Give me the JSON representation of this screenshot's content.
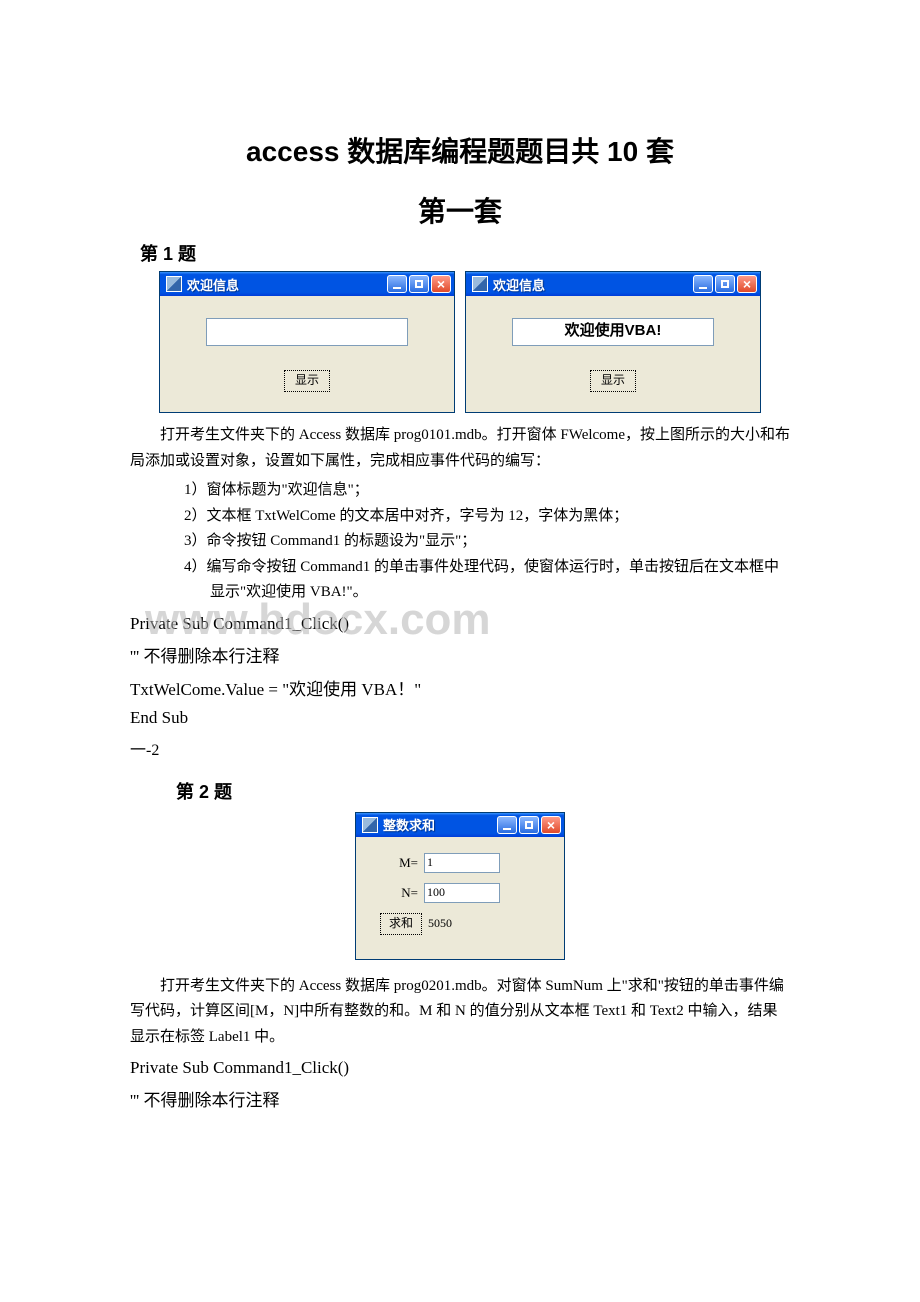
{
  "title": "access 数据库编程题题目共 10 套",
  "set_heading": "第一套",
  "watermark": "www.bdocx.com",
  "q1": {
    "header": "第 1 题",
    "win_left": {
      "title": "欢迎信息",
      "text_value": "",
      "button_label": "显示"
    },
    "win_right": {
      "title": "欢迎信息",
      "text_value": "欢迎使用VBA!",
      "button_label": "显示"
    },
    "para1": "打开考生文件夹下的 Access 数据库 prog0101.mdb。打开窗体 FWelcome，按上图所示的大小和布局添加或设置对象，设置如下属性，完成相应事件代码的编写：",
    "items": [
      "1）窗体标题为\"欢迎信息\"；",
      "2）文本框 TxtWelCome 的文本居中对齐，字号为 12，字体为黑体；",
      "3）命令按钮 Command1 的标题设为\"显示\"；",
      "4）编写命令按钮 Command1 的单击事件处理代码，使窗体运行时，单击按钮后在文本框中显示\"欢迎使用 VBA!\"。"
    ],
    "code": {
      "l1": "Private Sub Command1_Click()",
      "l2": "''' 不得删除本行注释",
      "l3": " TxtWelCome.Value = \"欢迎使用 VBA！\"",
      "l4": "End Sub"
    },
    "footer": "一-2"
  },
  "q2": {
    "header": "第 2 题",
    "win": {
      "title": "整数求和",
      "m_label": "M=",
      "m_value": "1",
      "n_label": "N=",
      "n_value": "100",
      "button_label": "求和",
      "result": "5050"
    },
    "para1": "打开考生文件夹下的 Access 数据库 prog0201.mdb。对窗体 SumNum 上\"求和\"按钮的单击事件编写代码，计算区间[M，N]中所有整数的和。M 和 N 的值分别从文本框 Text1 和 Text2 中输入，结果显示在标签 Label1 中。",
    "code": {
      "l1": "Private Sub Command1_Click()",
      "l2": "''' 不得删除本行注释"
    }
  }
}
